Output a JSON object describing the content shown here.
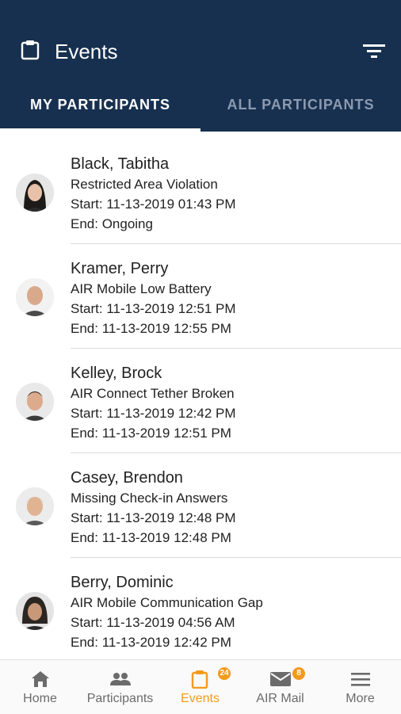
{
  "app_bar": {
    "title": "Events",
    "icon": "clipboard-icon",
    "action_icon": "filter-icon",
    "background": "#17304f"
  },
  "tabs": [
    {
      "label": "MY PARTICIPANTS",
      "active": true
    },
    {
      "label": "ALL PARTICIPANTS",
      "active": false
    }
  ],
  "events": [
    {
      "name": "Black, Tabitha",
      "event": "Restricted Area Violation",
      "start": "Start: 11-13-2019 01:43 PM",
      "end": "End: Ongoing"
    },
    {
      "name": "Kramer, Perry",
      "event": "AIR Mobile Low Battery",
      "start": "Start: 11-13-2019 12:51 PM",
      "end": "End: 11-13-2019 12:55 PM"
    },
    {
      "name": "Kelley, Brock",
      "event": "AIR Connect Tether Broken",
      "start": "Start: 11-13-2019 12:42 PM",
      "end": "End: 11-13-2019 12:51 PM"
    },
    {
      "name": "Casey, Brendon",
      "event": "Missing Check-in Answers",
      "start": "Start: 11-13-2019 12:48 PM",
      "end": "End: 11-13-2019 12:48 PM"
    },
    {
      "name": "Berry, Dominic",
      "event": "AIR Mobile Communication Gap",
      "start": "Start: 11-13-2019 04:56 AM",
      "end": "End: 11-13-2019 12:42 PM"
    }
  ],
  "bottom_nav": {
    "accent": "#f39a1e",
    "items": [
      {
        "label": "Home",
        "icon": "home-icon"
      },
      {
        "label": "Participants",
        "icon": "people-icon"
      },
      {
        "label": "Events",
        "icon": "clipboard-icon",
        "badge": "24",
        "active": true
      },
      {
        "label": "AIR Mail",
        "icon": "mail-icon",
        "badge": "8"
      },
      {
        "label": "More",
        "icon": "menu-icon"
      }
    ]
  }
}
